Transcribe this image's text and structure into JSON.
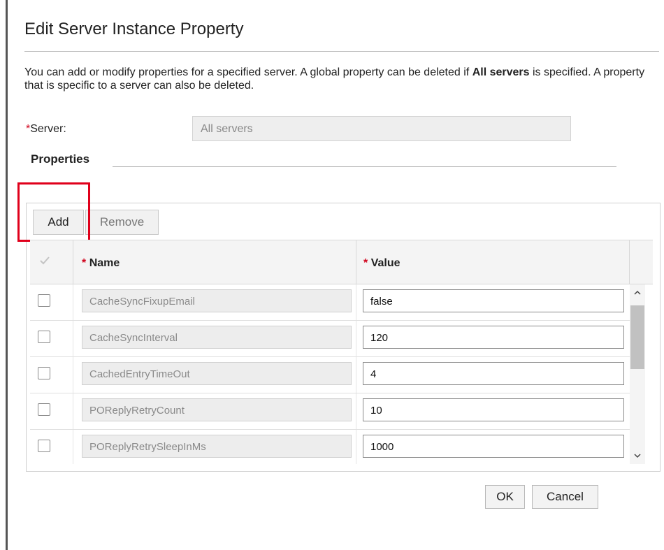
{
  "dialog": {
    "title": "Edit Server Instance Property",
    "description_part1": "You can add or modify properties for a specified server. A global property can be deleted if ",
    "description_bold": "All servers",
    "description_part2": " is specified. A property that is specific to a server can also be deleted."
  },
  "server": {
    "required_marker": "*",
    "label": "Server:",
    "value": "All servers"
  },
  "properties": {
    "label": "Properties",
    "toolbar": {
      "add_label": "Add",
      "remove_label": "Remove"
    },
    "columns": {
      "select_icon": "checkmark-icon",
      "name_required": "*",
      "name": "Name",
      "value_required": "*",
      "value": "Value"
    },
    "rows": [
      {
        "name": "CacheSyncFixupEmail",
        "value": "false"
      },
      {
        "name": "CacheSyncInterval",
        "value": "120"
      },
      {
        "name": "CachedEntryTimeOut",
        "value": "4"
      },
      {
        "name": "POReplyRetryCount",
        "value": "10"
      },
      {
        "name": "POReplyRetrySleepInMs",
        "value": "1000"
      }
    ]
  },
  "footer": {
    "ok_label": "OK",
    "cancel_label": "Cancel"
  },
  "colors": {
    "required": "#d0021b",
    "highlight": "#e0001b"
  }
}
